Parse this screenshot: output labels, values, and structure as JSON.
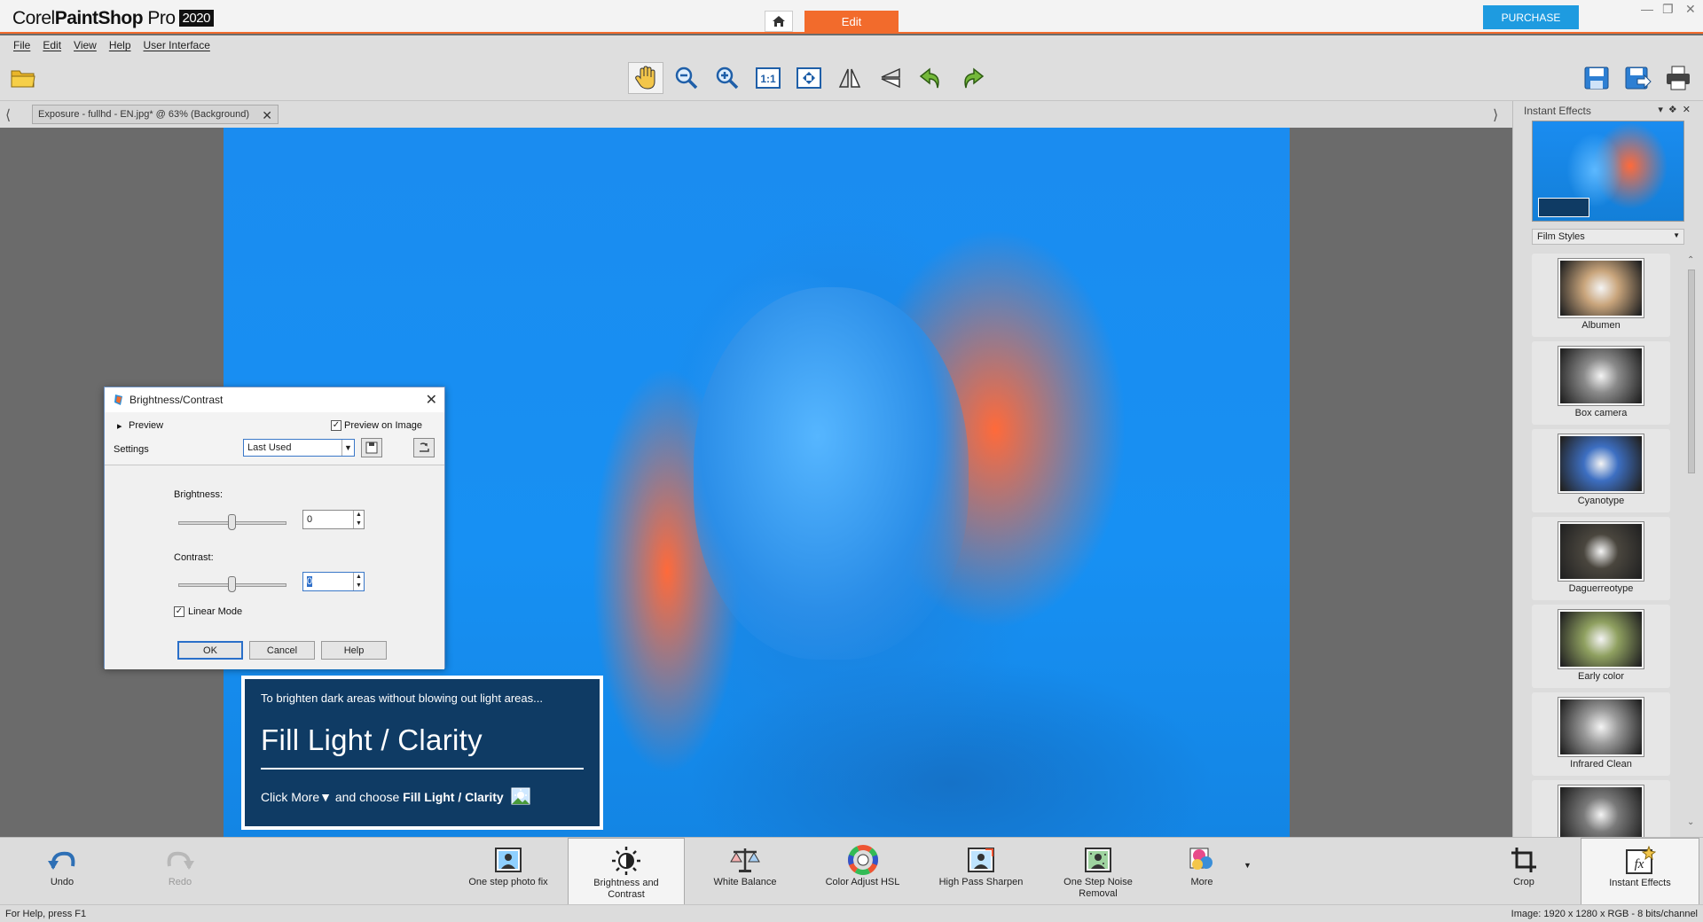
{
  "app": {
    "brand_light": "Corel",
    "brand_bold": "PaintShop",
    "brand_tail": " Pro",
    "version": "2020",
    "edit_tab": "Edit",
    "purchase": "PURCHASE"
  },
  "menu": [
    "File",
    "Edit",
    "View",
    "Help",
    "User Interface"
  ],
  "document_tab": "Exposure - fullhd - EN.jpg* @  63% (Background)",
  "tip_card": {
    "line1": "To brighten dark areas without blowing out light areas...",
    "title": "Fill Light / Clarity",
    "line3_a": "Click More",
    "line3_b": " and choose ",
    "line3_c": "Fill Light / Clarity"
  },
  "dialog": {
    "title": "Brightness/Contrast",
    "preview": "Preview",
    "preview_on_image": "Preview on Image",
    "settings_label": "Settings",
    "settings_value": "Last Used",
    "brightness_label": "Brightness:",
    "brightness_value": "0",
    "contrast_label": "Contrast:",
    "contrast_value": "0",
    "linear_mode": "Linear Mode",
    "ok": "OK",
    "cancel": "Cancel",
    "help": "Help"
  },
  "right_panel": {
    "title": "Instant Effects",
    "category": "Film Styles",
    "effects": [
      {
        "name": "Albumen",
        "color": "#c9a57c"
      },
      {
        "name": "Box camera",
        "color": "#8a8a8a"
      },
      {
        "name": "Cyanotype",
        "color": "#3d6fc2"
      },
      {
        "name": "Daguerreotype",
        "color": "#4a463e"
      },
      {
        "name": "Early color",
        "color": "#8fa060"
      },
      {
        "name": "Infrared Clean",
        "color": "#9a9a9a"
      },
      {
        "name": "",
        "color": "#7a7a7a"
      }
    ]
  },
  "bottom_bar": {
    "undo": "Undo",
    "redo": "Redo",
    "one_step_photo_fix": "One step photo fix",
    "brightness_contrast_1": "Brightness and",
    "brightness_contrast_2": "Contrast",
    "white_balance": "White Balance",
    "color_adjust_hsl": "Color Adjust HSL",
    "high_pass_sharpen": "High Pass Sharpen",
    "noise_1": "One Step Noise",
    "noise_2": "Removal",
    "more": "More",
    "crop": "Crop",
    "instant_effects": "Instant Effects"
  },
  "status": {
    "left": "For Help, press F1",
    "right": "Image:  1920 x 1280 x RGB - 8 bits/channel"
  },
  "colors": {
    "accent": "#f26b2c",
    "purchase": "#1e9be0"
  }
}
